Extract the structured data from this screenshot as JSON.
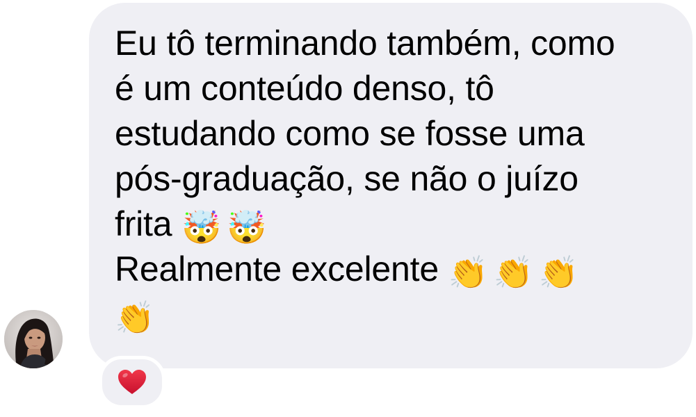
{
  "message": {
    "lines": [
      "Eu tô terminando também, como",
      "é um conteúdo denso, tô",
      "estudando como se fosse uma",
      "pós-graduação, se não o juízo",
      "frita",
      "Realmente excelente"
    ],
    "emoji_after_line_5": [
      "🤯",
      "🤯"
    ],
    "emoji_after_line_6": [
      "👏",
      "👏",
      "👏"
    ],
    "emoji_line_7": [
      "👏"
    ]
  },
  "sender": {
    "avatar_icon": "profile-photo-woman"
  },
  "reaction": {
    "icon": "red-heart-icon",
    "color": "#e0243a"
  },
  "colors": {
    "bubble": "#efeff4",
    "text": "#000000",
    "background": "#ffffff"
  }
}
